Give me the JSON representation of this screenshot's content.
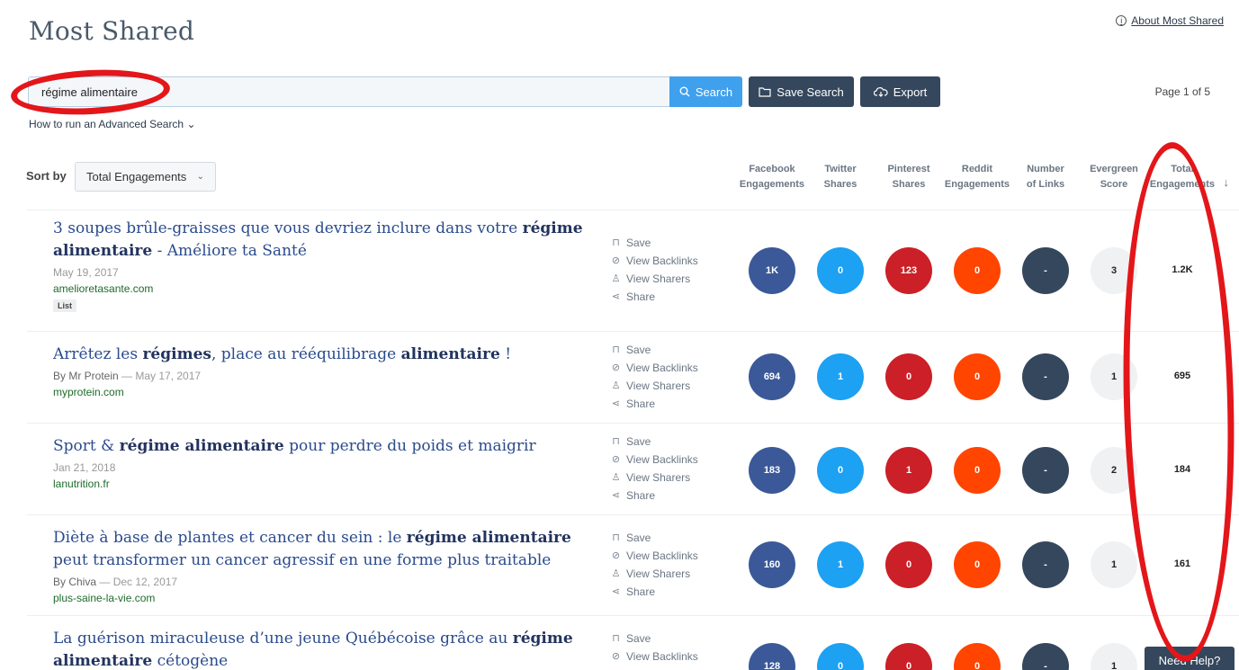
{
  "header": {
    "title": "Most Shared",
    "about_link": "About Most Shared"
  },
  "search": {
    "value": "régime alimentaire",
    "search_label": "Search",
    "save_search_label": "Save Search",
    "export_label": "Export",
    "advanced_link": "How to run an Advanced Search"
  },
  "pagination": {
    "text": "Page 1 of 5"
  },
  "sort": {
    "label": "Sort by",
    "selected": "Total Engagements"
  },
  "columns": [
    {
      "line1": "Facebook",
      "line2": "Engagements"
    },
    {
      "line1": "Twitter",
      "line2": "Shares"
    },
    {
      "line1": "Pinterest",
      "line2": "Shares"
    },
    {
      "line1": "Reddit",
      "line2": "Engagements"
    },
    {
      "line1": "Number",
      "line2": "of Links"
    },
    {
      "line1": "Evergreen",
      "line2": "Score"
    },
    {
      "line1": "Total",
      "line2": "Engagements"
    }
  ],
  "actions": {
    "save": "Save",
    "backlinks": "View Backlinks",
    "sharers": "View Sharers",
    "share": "Share"
  },
  "colors": {
    "facebook": "#3b5998",
    "twitter": "#1da1f2",
    "pinterest": "#cb2027",
    "reddit": "#ff4500",
    "links": "#35475c",
    "evergreen": "#f0f1f2",
    "annotation": "#e3161a"
  },
  "results": [
    {
      "title_parts": [
        {
          "text": "3 soupes brûle-graisses que vous devriez inclure dans votre ",
          "bold": false
        },
        {
          "text": "régime alimentaire",
          "bold": true
        },
        {
          "text": " - Améliore ta Santé",
          "bold": false
        }
      ],
      "author": "",
      "date": "May 19, 2017",
      "domain": "amelioretasante.com",
      "tag": "List",
      "facebook": "1K",
      "twitter": "0",
      "pinterest": "123",
      "reddit": "0",
      "links": "-",
      "evergreen": "3",
      "total": "1.2K"
    },
    {
      "title_parts": [
        {
          "text": "Arrêtez les ",
          "bold": false
        },
        {
          "text": "régimes",
          "bold": true
        },
        {
          "text": ", place au rééquilibrage ",
          "bold": false
        },
        {
          "text": "alimentaire",
          "bold": true
        },
        {
          "text": " !",
          "bold": false
        }
      ],
      "author": "By Mr Protein",
      "date": "May 17, 2017",
      "domain": "myprotein.com",
      "tag": "",
      "facebook": "694",
      "twitter": "1",
      "pinterest": "0",
      "reddit": "0",
      "links": "-",
      "evergreen": "1",
      "total": "695"
    },
    {
      "title_parts": [
        {
          "text": "Sport & ",
          "bold": false
        },
        {
          "text": "régime alimentaire",
          "bold": true
        },
        {
          "text": " pour perdre du poids et maigrir",
          "bold": false
        }
      ],
      "author": "",
      "date": "Jan 21, 2018",
      "domain": "lanutrition.fr",
      "tag": "",
      "facebook": "183",
      "twitter": "0",
      "pinterest": "1",
      "reddit": "0",
      "links": "-",
      "evergreen": "2",
      "total": "184"
    },
    {
      "title_parts": [
        {
          "text": "Diète à base de plantes et cancer du sein : le ",
          "bold": false
        },
        {
          "text": "régime alimentaire",
          "bold": true
        },
        {
          "text": " peut transformer un cancer agressif en une forme plus traitable",
          "bold": false
        }
      ],
      "author": "By Chiva",
      "date": "Dec 12, 2017",
      "domain": "plus-saine-la-vie.com",
      "tag": "",
      "facebook": "160",
      "twitter": "1",
      "pinterest": "0",
      "reddit": "0",
      "links": "-",
      "evergreen": "1",
      "total": "161"
    },
    {
      "title_parts": [
        {
          "text": "La guérison miraculeuse d’une jeune Québécoise grâce au ",
          "bold": false
        },
        {
          "text": "régime alimentaire",
          "bold": true
        },
        {
          "text": " cétogène",
          "bold": false
        }
      ],
      "author": "",
      "date": "",
      "domain": "",
      "tag": "",
      "facebook": "128",
      "twitter": "0",
      "pinterest": "0",
      "reddit": "0",
      "links": "-",
      "evergreen": "1",
      "total": ""
    }
  ],
  "help": {
    "label": "Need Help?"
  }
}
